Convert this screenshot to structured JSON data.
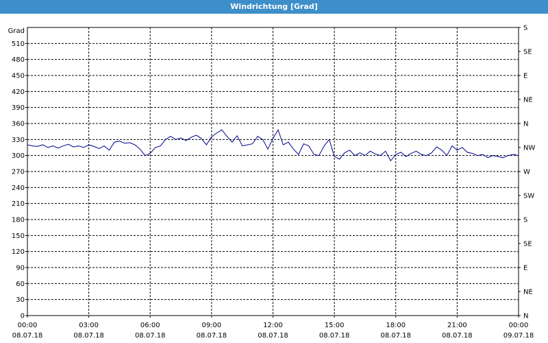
{
  "window": {
    "title": "Windrichtung [Grad]"
  },
  "colors": {
    "titlebar": "#3d8fc9",
    "series": "#00008b",
    "grid": "#000000"
  },
  "chart_data": {
    "type": "line",
    "title": "Windrichtung [Grad]",
    "ylabel": "Grad",
    "ylim": [
      0,
      540
    ],
    "y_ticks": [
      0,
      30,
      60,
      90,
      120,
      150,
      180,
      210,
      240,
      270,
      300,
      330,
      360,
      390,
      420,
      450,
      480,
      510
    ],
    "right_axis_labels": [
      {
        "value": 0,
        "label": "N"
      },
      {
        "value": 45,
        "label": "NE"
      },
      {
        "value": 90,
        "label": "E"
      },
      {
        "value": 135,
        "label": "SE"
      },
      {
        "value": 180,
        "label": "S"
      },
      {
        "value": 225,
        "label": "SW"
      },
      {
        "value": 270,
        "label": "W"
      },
      {
        "value": 315,
        "label": "NW"
      },
      {
        "value": 360,
        "label": "N"
      },
      {
        "value": 405,
        "label": "NE"
      },
      {
        "value": 450,
        "label": "E"
      },
      {
        "value": 495,
        "label": "SE"
      },
      {
        "value": 540,
        "label": "S"
      }
    ],
    "xlim_hours": [
      0,
      24
    ],
    "x_ticks": [
      {
        "hour": 0,
        "time": "00:00",
        "date": "08.07.18"
      },
      {
        "hour": 3,
        "time": "03:00",
        "date": "08.07.18"
      },
      {
        "hour": 6,
        "time": "06:00",
        "date": "08.07.18"
      },
      {
        "hour": 9,
        "time": "09:00",
        "date": "08.07.18"
      },
      {
        "hour": 12,
        "time": "12:00",
        "date": "08.07.18"
      },
      {
        "hour": 15,
        "time": "15:00",
        "date": "08.07.18"
      },
      {
        "hour": 18,
        "time": "18:00",
        "date": "08.07.18"
      },
      {
        "hour": 21,
        "time": "21:00",
        "date": "08.07.18"
      },
      {
        "hour": 24,
        "time": "00:00",
        "date": "09.07.18"
      }
    ],
    "grid": true,
    "series": [
      {
        "x": [
          0,
          0.25,
          0.5,
          0.75,
          1.0,
          1.25,
          1.5,
          1.75,
          2.0,
          2.25,
          2.5,
          2.75,
          3.0,
          3.25,
          3.5,
          3.75,
          4.0,
          4.25,
          4.5,
          4.75,
          5.0,
          5.25,
          5.5,
          5.75,
          6.0,
          6.25,
          6.5,
          6.75,
          7.0,
          7.25,
          7.5,
          7.75,
          8.0,
          8.25,
          8.5,
          8.75,
          9.0,
          9.25,
          9.5,
          9.75,
          10.0,
          10.25,
          10.5,
          10.75,
          11.0,
          11.25,
          11.5,
          11.75,
          12.0,
          12.25,
          12.5,
          12.75,
          13.0,
          13.25,
          13.5,
          13.75,
          14.0,
          14.25,
          14.5,
          14.75,
          15.0,
          15.25,
          15.5,
          15.75,
          16.0,
          16.25,
          16.5,
          16.75,
          17.0,
          17.25,
          17.5,
          17.75,
          18.0,
          18.25,
          18.5,
          18.75,
          19.0,
          19.25,
          19.5,
          19.75,
          20.0,
          20.25,
          20.5,
          20.75,
          21.0,
          21.25,
          21.5,
          21.75,
          22.0,
          22.25,
          22.5,
          22.75,
          23.0,
          23.25,
          23.5,
          23.75,
          24.0
        ],
        "y": [
          320,
          318,
          317,
          320,
          315,
          318,
          314,
          318,
          321,
          316,
          318,
          315,
          320,
          317,
          313,
          318,
          310,
          325,
          327,
          323,
          324,
          320,
          312,
          300,
          304,
          315,
          318,
          330,
          336,
          330,
          333,
          328,
          334,
          338,
          332,
          320,
          335,
          342,
          348,
          336,
          325,
          337,
          318,
          320,
          322,
          336,
          330,
          312,
          332,
          348,
          320,
          325,
          312,
          302,
          322,
          318,
          302,
          300,
          318,
          330,
          298,
          293,
          305,
          310,
          300,
          305,
          300,
          308,
          303,
          300,
          308,
          290,
          302,
          306,
          298,
          304,
          308,
          302,
          300,
          305,
          316,
          310,
          300,
          318,
          310,
          315,
          306,
          304,
          300,
          302,
          296,
          300,
          298,
          296,
          300,
          302,
          300
        ]
      }
    ]
  }
}
